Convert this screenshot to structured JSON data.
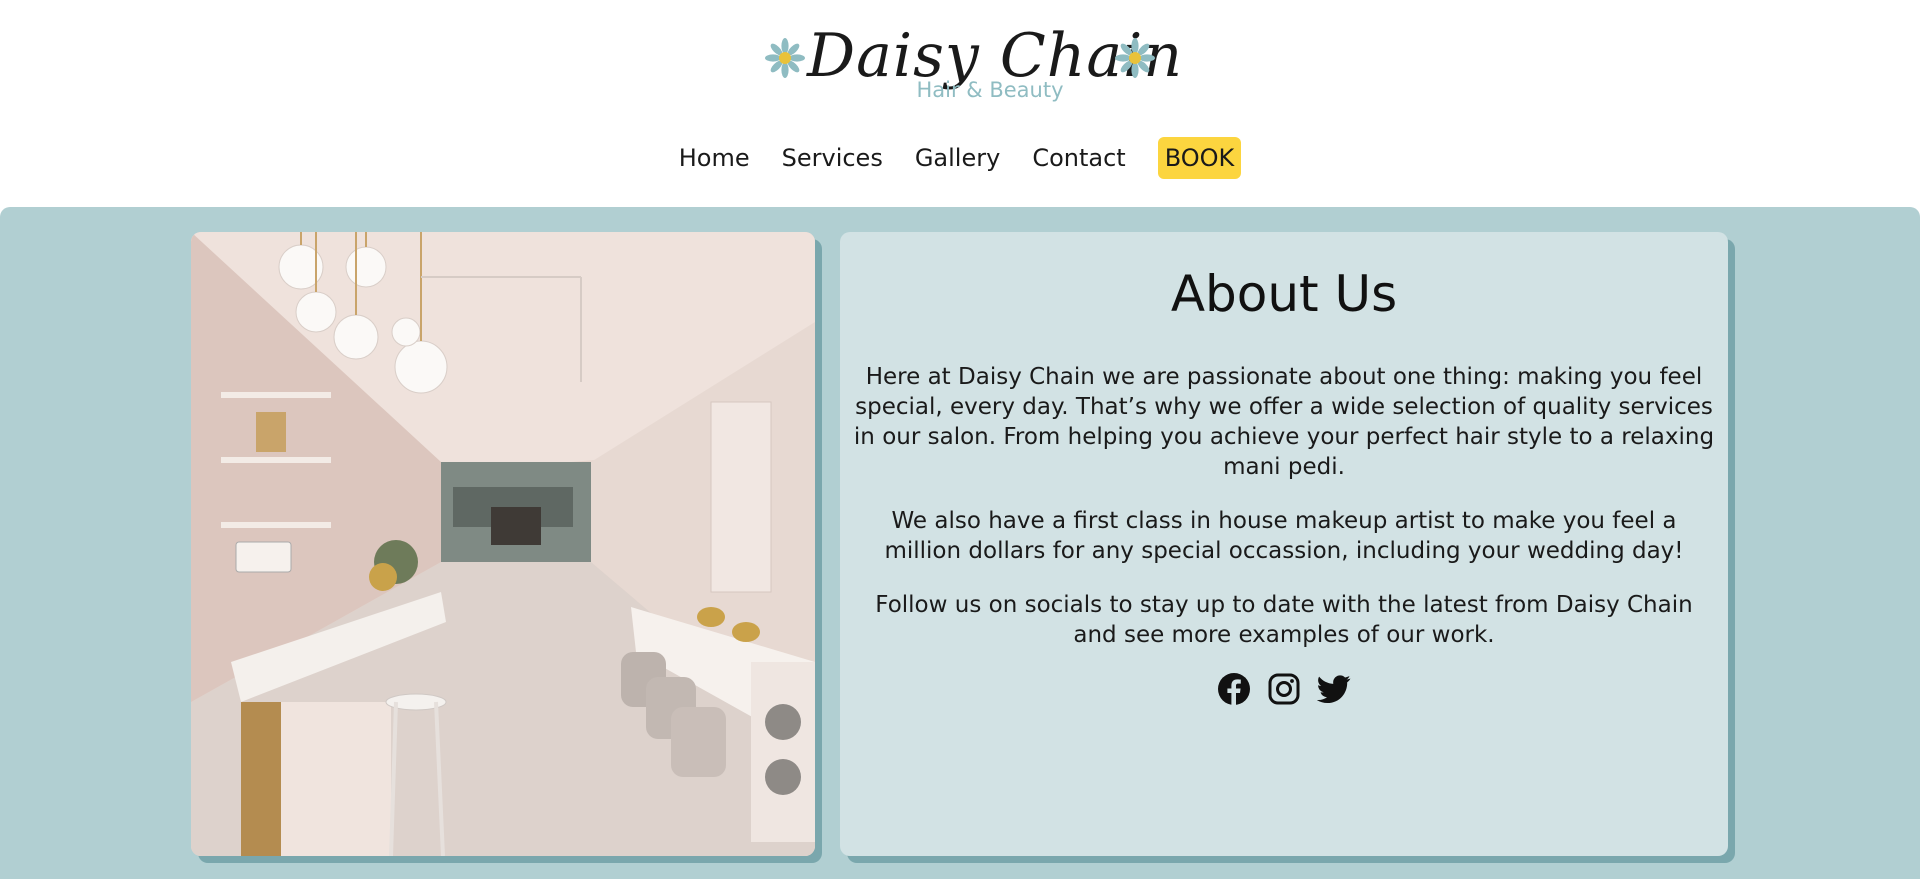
{
  "brand": {
    "name": "Daisy Chain",
    "tagline": "Hair & Beauty",
    "flower_color": "#8fbcc2"
  },
  "nav": {
    "items": [
      {
        "label": "Home"
      },
      {
        "label": "Services"
      },
      {
        "label": "Gallery"
      },
      {
        "label": "Contact"
      }
    ],
    "book_label": "BOOK",
    "book_color": "#fcd53f"
  },
  "colors": {
    "band": "#b1cfd2",
    "card": "#d2e2e4",
    "shadow": "#7aa7ad"
  },
  "about": {
    "title": "About Us",
    "paragraphs": [
      "Here at Daisy Chain we are passionate about one thing: making you feel special, every day. That’s why we offer a wide selection of quality services in our salon. From helping you achieve your perfect hair style to a relaxing mani pedi.",
      "We also have a first class in house makeup artist to make you feel a million dollars for any special occassion, including your wedding day!",
      "Follow us on socials to stay up to date with the latest from Daisy Chain and see more examples of our work."
    ]
  },
  "socials": [
    {
      "icon": "facebook-icon"
    },
    {
      "icon": "instagram-icon"
    },
    {
      "icon": "twitter-icon"
    }
  ]
}
